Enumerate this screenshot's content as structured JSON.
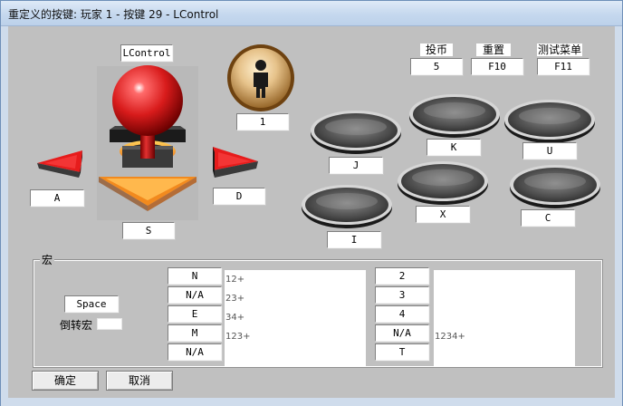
{
  "window": {
    "title": "重定义的按键: 玩家 1 - 按键 29 - LControl"
  },
  "joystick": {
    "top_label": "LControl",
    "left_label": "A",
    "right_label": "D",
    "down_label": "S",
    "colors": {
      "ball": "#d81b1b",
      "arrow": "#e61c1c",
      "base": "#f07d1d"
    }
  },
  "start_button": {
    "label": "1",
    "icon": "person-icon"
  },
  "top_keys": [
    {
      "caption": "投币",
      "value": "5"
    },
    {
      "caption": "重置",
      "value": "F10"
    },
    {
      "caption": "测试菜单",
      "value": "F11"
    }
  ],
  "action_buttons": {
    "J": "J",
    "K": "K",
    "U": "U",
    "X": "X",
    "C": "C",
    "I": "I"
  },
  "macro": {
    "group_title": "宏",
    "key_label": "Space",
    "reverse_label": "倒转宏",
    "left_buttons": [
      "N",
      "N/A",
      "E",
      "M",
      "N/A"
    ],
    "left_values": [
      "12+",
      "23+",
      "34+",
      "123+",
      ""
    ],
    "right_buttons": [
      "2",
      "3",
      "4",
      "N/A",
      "T"
    ],
    "right_values": [
      "",
      "",
      "",
      "1234+",
      ""
    ]
  },
  "dialog": {
    "ok_label": "确定",
    "cancel_label": "取消"
  }
}
